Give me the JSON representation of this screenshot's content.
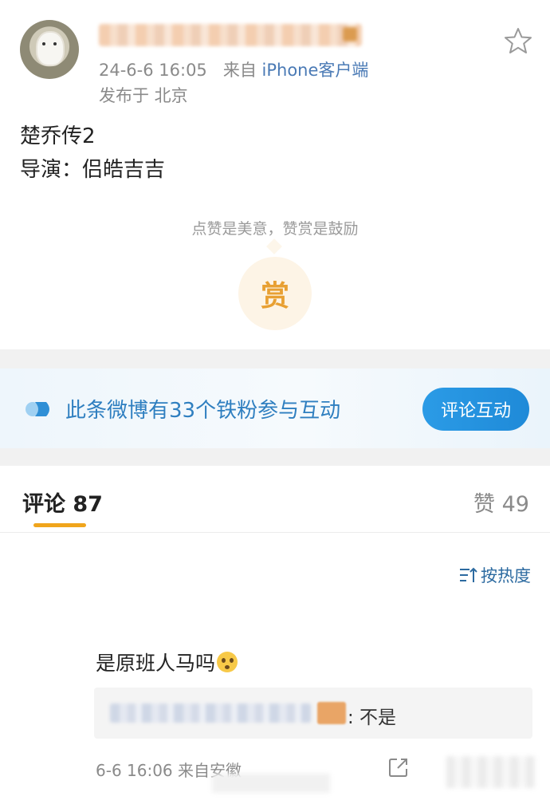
{
  "post": {
    "timestamp": "24-6-6 16:05",
    "source_prefix": "来自",
    "source": "iPhone客户端",
    "location": "发布于 北京",
    "text_line1": "楚乔传2",
    "text_line2": "导演：侣皓吉吉"
  },
  "reward": {
    "hint": "点赞是美意，赞赏是鼓励",
    "button_label": "赏"
  },
  "fan_banner": {
    "text": "此条微博有33个铁粉参与互动",
    "button_label": "评论互动"
  },
  "tabs": {
    "comments": "评论 87",
    "likes": "赞 49"
  },
  "sort": {
    "label": "按热度"
  },
  "comment": {
    "text": "是原班人马吗",
    "reply_text": ": 不是",
    "meta": "6-6 16:06  来自安徽"
  },
  "colors": {
    "link_blue": "#4a7ab5",
    "accent_orange": "#f0a51c",
    "button_blue": "#1f8ad8",
    "reward_gold": "#e8a033"
  },
  "icons": [
    "star-icon",
    "fan-icon",
    "sort-icon",
    "share-icon",
    "emoji-icon"
  ]
}
